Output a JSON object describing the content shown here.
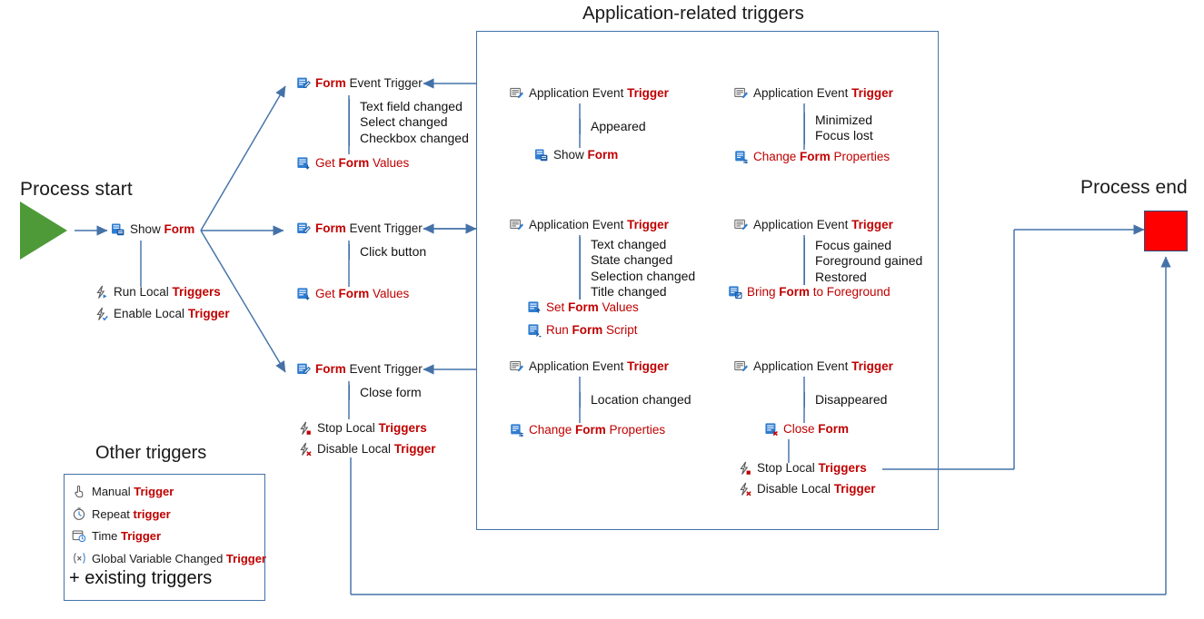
{
  "diagram": {
    "title_main": "Application-related triggers",
    "label_process_start": "Process start",
    "label_process_end": "Process end",
    "label_other_triggers": "Other triggers",
    "colors": {
      "accent_line": "#4472a8",
      "highlight_text": "#c00000",
      "start_shape": "#4e9a39",
      "end_shape": "#fe0000"
    }
  },
  "left_flow": {
    "show_form": {
      "icon": "show-form-icon",
      "pre": "Show ",
      "key": "Form",
      "post": ""
    },
    "under_show_form": [
      {
        "icon": "run-local-triggers-icon",
        "pre": "Run Local ",
        "key": "Triggers",
        "post": ""
      },
      {
        "icon": "enable-local-trigger-icon",
        "pre": "Enable Local ",
        "key": "Trigger",
        "post": ""
      }
    ]
  },
  "form_branches": [
    {
      "trigger": {
        "icon": "form-event-trigger-icon",
        "pre": "",
        "key": "Form",
        "post": " Event Trigger"
      },
      "events": [
        "Text field changed",
        "Select changed",
        "Checkbox changed"
      ],
      "actions": [
        {
          "icon": "get-form-values-icon",
          "pre": "Get ",
          "key": "Form",
          "post": " Values"
        }
      ]
    },
    {
      "trigger": {
        "icon": "form-event-trigger-icon",
        "pre": "",
        "key": "Form",
        "post": " Event Trigger"
      },
      "events": [
        "Click button"
      ],
      "actions": [
        {
          "icon": "get-form-values-icon",
          "pre": "Get ",
          "key": "Form",
          "post": " Values"
        }
      ]
    },
    {
      "trigger": {
        "icon": "form-event-trigger-icon",
        "pre": "",
        "key": "Form",
        "post": " Event Trigger"
      },
      "events": [
        "Close form"
      ],
      "actions": [
        {
          "icon": "stop-local-triggers-icon",
          "pre": "Stop Local ",
          "key": "Triggers",
          "post": ""
        },
        {
          "icon": "disable-local-trigger-icon",
          "pre": "Disable Local ",
          "key": "Trigger",
          "post": ""
        }
      ]
    }
  ],
  "app_groups": [
    {
      "trigger": {
        "icon": "application-event-trigger-icon",
        "pre": "Application Event ",
        "key": "Trigger",
        "post": ""
      },
      "events": [
        "Appeared"
      ],
      "actions": [
        {
          "icon": "show-form-icon",
          "pre": "Show ",
          "key": "Form",
          "post": ""
        }
      ]
    },
    {
      "trigger": {
        "icon": "application-event-trigger-icon",
        "pre": "Application Event ",
        "key": "Trigger",
        "post": ""
      },
      "events": [
        "Minimized",
        "Focus lost"
      ],
      "actions": [
        {
          "icon": "change-form-properties-icon",
          "pre": "Change ",
          "key": "Form",
          "post": " Properties"
        }
      ]
    },
    {
      "trigger": {
        "icon": "application-event-trigger-icon",
        "pre": "Application Event ",
        "key": "Trigger",
        "post": ""
      },
      "events": [
        "Text changed",
        "State changed",
        "Selection changed",
        "Title changed"
      ],
      "actions": [
        {
          "icon": "set-form-values-icon",
          "pre": "Set ",
          "key": "Form",
          "post": " Values"
        },
        {
          "icon": "run-form-script-icon",
          "pre": "Run ",
          "key": "Form",
          "post": " Script"
        }
      ]
    },
    {
      "trigger": {
        "icon": "application-event-trigger-icon",
        "pre": "Application Event ",
        "key": "Trigger",
        "post": ""
      },
      "events": [
        "Focus gained",
        "Foreground gained",
        "Restored"
      ],
      "actions": [
        {
          "icon": "bring-form-to-foreground-icon",
          "pre": "Bring ",
          "key": "Form",
          "post": " to Foreground"
        }
      ]
    },
    {
      "trigger": {
        "icon": "application-event-trigger-icon",
        "pre": "Application Event ",
        "key": "Trigger",
        "post": ""
      },
      "events": [
        "Location changed"
      ],
      "actions": [
        {
          "icon": "change-form-properties-icon",
          "pre": "Change ",
          "key": "Form",
          "post": " Properties"
        }
      ]
    },
    {
      "trigger": {
        "icon": "application-event-trigger-icon",
        "pre": "Application Event ",
        "key": "Trigger",
        "post": ""
      },
      "events": [
        "Disappeared"
      ],
      "actions": [
        {
          "icon": "close-form-icon",
          "pre": "Close ",
          "key": "Form",
          "post": ""
        },
        {
          "icon": "stop-local-triggers-icon",
          "pre": "Stop Local ",
          "key": "Triggers",
          "post": ""
        },
        {
          "icon": "disable-local-trigger-icon",
          "pre": "Disable Local ",
          "key": "Trigger",
          "post": ""
        }
      ]
    }
  ],
  "other_triggers": {
    "items": [
      {
        "icon": "manual-trigger-icon",
        "pre": "Manual ",
        "key": "Trigger",
        "post": ""
      },
      {
        "icon": "repeat-trigger-icon",
        "pre": "Repeat ",
        "key": "trigger",
        "post": ""
      },
      {
        "icon": "time-trigger-icon",
        "pre": "Time ",
        "key": "Trigger",
        "post": ""
      },
      {
        "icon": "global-variable-changed-trigger-icon",
        "pre": "Global Variable Changed ",
        "key": "Trigger",
        "post": ""
      }
    ],
    "footer": "+ existing triggers"
  }
}
